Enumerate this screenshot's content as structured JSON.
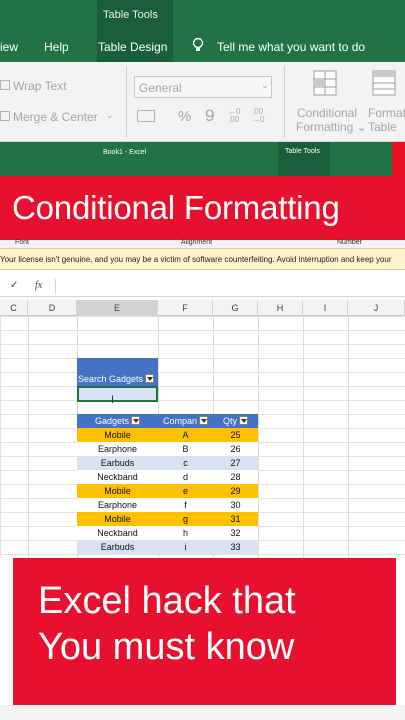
{
  "ribbon": {
    "context_label": "Table Tools",
    "tabs": [
      "iew",
      "Help",
      "Table Design"
    ],
    "tell_me": "Tell me what you want to do",
    "wrap_text": "Wrap Text",
    "merge_center": "Merge & Center",
    "number_format": "General",
    "percent": "%",
    "comma": "9",
    "dec_inc": "←0 .00",
    "dec_dec": ".00 →0",
    "conditional_formatting": [
      "Conditional",
      "Formatting"
    ],
    "format_as_table": [
      "Formatt",
      "Table"
    ]
  },
  "window2": {
    "title": "Book1 - Excel",
    "context_label": "Table Tools"
  },
  "banner_top": "Conditional Formatting",
  "groups": {
    "font": "Font",
    "alignment": "Alignment",
    "number": "Number"
  },
  "warning": "Your license isn't genuine, and you may be a victim of software counterfeiting. Avoid interruption and keep your",
  "formula_bar": {
    "fx": "fx"
  },
  "columns": [
    "C",
    "D",
    "E",
    "F",
    "G",
    "H",
    "I",
    "J"
  ],
  "search": {
    "header": "Search Gadgets"
  },
  "table": {
    "headers": [
      "Gadgets",
      "Compan",
      "Qty"
    ],
    "rows": [
      {
        "gadget": "Mobile",
        "company": "A",
        "qty": "25",
        "style": "orange"
      },
      {
        "gadget": "Earphone",
        "company": "B",
        "qty": "26",
        "style": "white"
      },
      {
        "gadget": "Earbuds",
        "company": "c",
        "qty": "27",
        "style": "lblue"
      },
      {
        "gadget": "Neckband",
        "company": "d",
        "qty": "28",
        "style": "white"
      },
      {
        "gadget": "Mobile",
        "company": "e",
        "qty": "29",
        "style": "orange"
      },
      {
        "gadget": "Earphone",
        "company": "f",
        "qty": "30",
        "style": "white"
      },
      {
        "gadget": "Mobile",
        "company": "g",
        "qty": "31",
        "style": "orange"
      },
      {
        "gadget": "Neckband",
        "company": "h",
        "qty": "32",
        "style": "white"
      },
      {
        "gadget": "Earbuds",
        "company": "i",
        "qty": "33",
        "style": "lblue"
      }
    ]
  },
  "banner_bottom": [
    "Excel hack that",
    "You must know"
  ],
  "colors": {
    "excel_green": "#217346",
    "banner_red": "#e8102f",
    "table_blue": "#4472c4",
    "highlight_orange": "#ffc000"
  }
}
